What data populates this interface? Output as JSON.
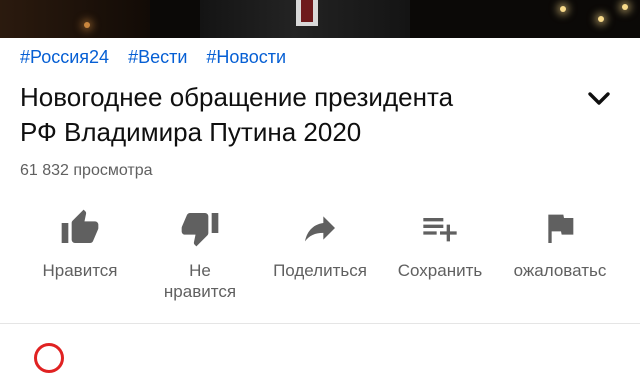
{
  "hashtags": [
    "#Россия24",
    "#Вести",
    "#Новости"
  ],
  "video": {
    "title_line1": "Новогоднее обращение президента",
    "title_line2": "РФ Владимира Путина 2020",
    "views": "61 832 просмотра"
  },
  "actions": {
    "like": "Нравится",
    "dislike_line1": "Не",
    "dislike_line2": "нравится",
    "share": "Поделиться",
    "save": "Сохранить",
    "report": "ожаловатьс"
  },
  "icons": {
    "like": "thumbs-up-icon",
    "dislike": "thumbs-down-icon",
    "share": "share-arrow-icon",
    "save": "playlist-add-icon",
    "report": "flag-icon",
    "expand": "chevron-down-icon"
  },
  "colors": {
    "hashtag": "#065fd4",
    "text_primary": "#0f0f0f",
    "text_secondary": "#606060",
    "icon": "#606060",
    "channel_ring": "#e02222"
  }
}
